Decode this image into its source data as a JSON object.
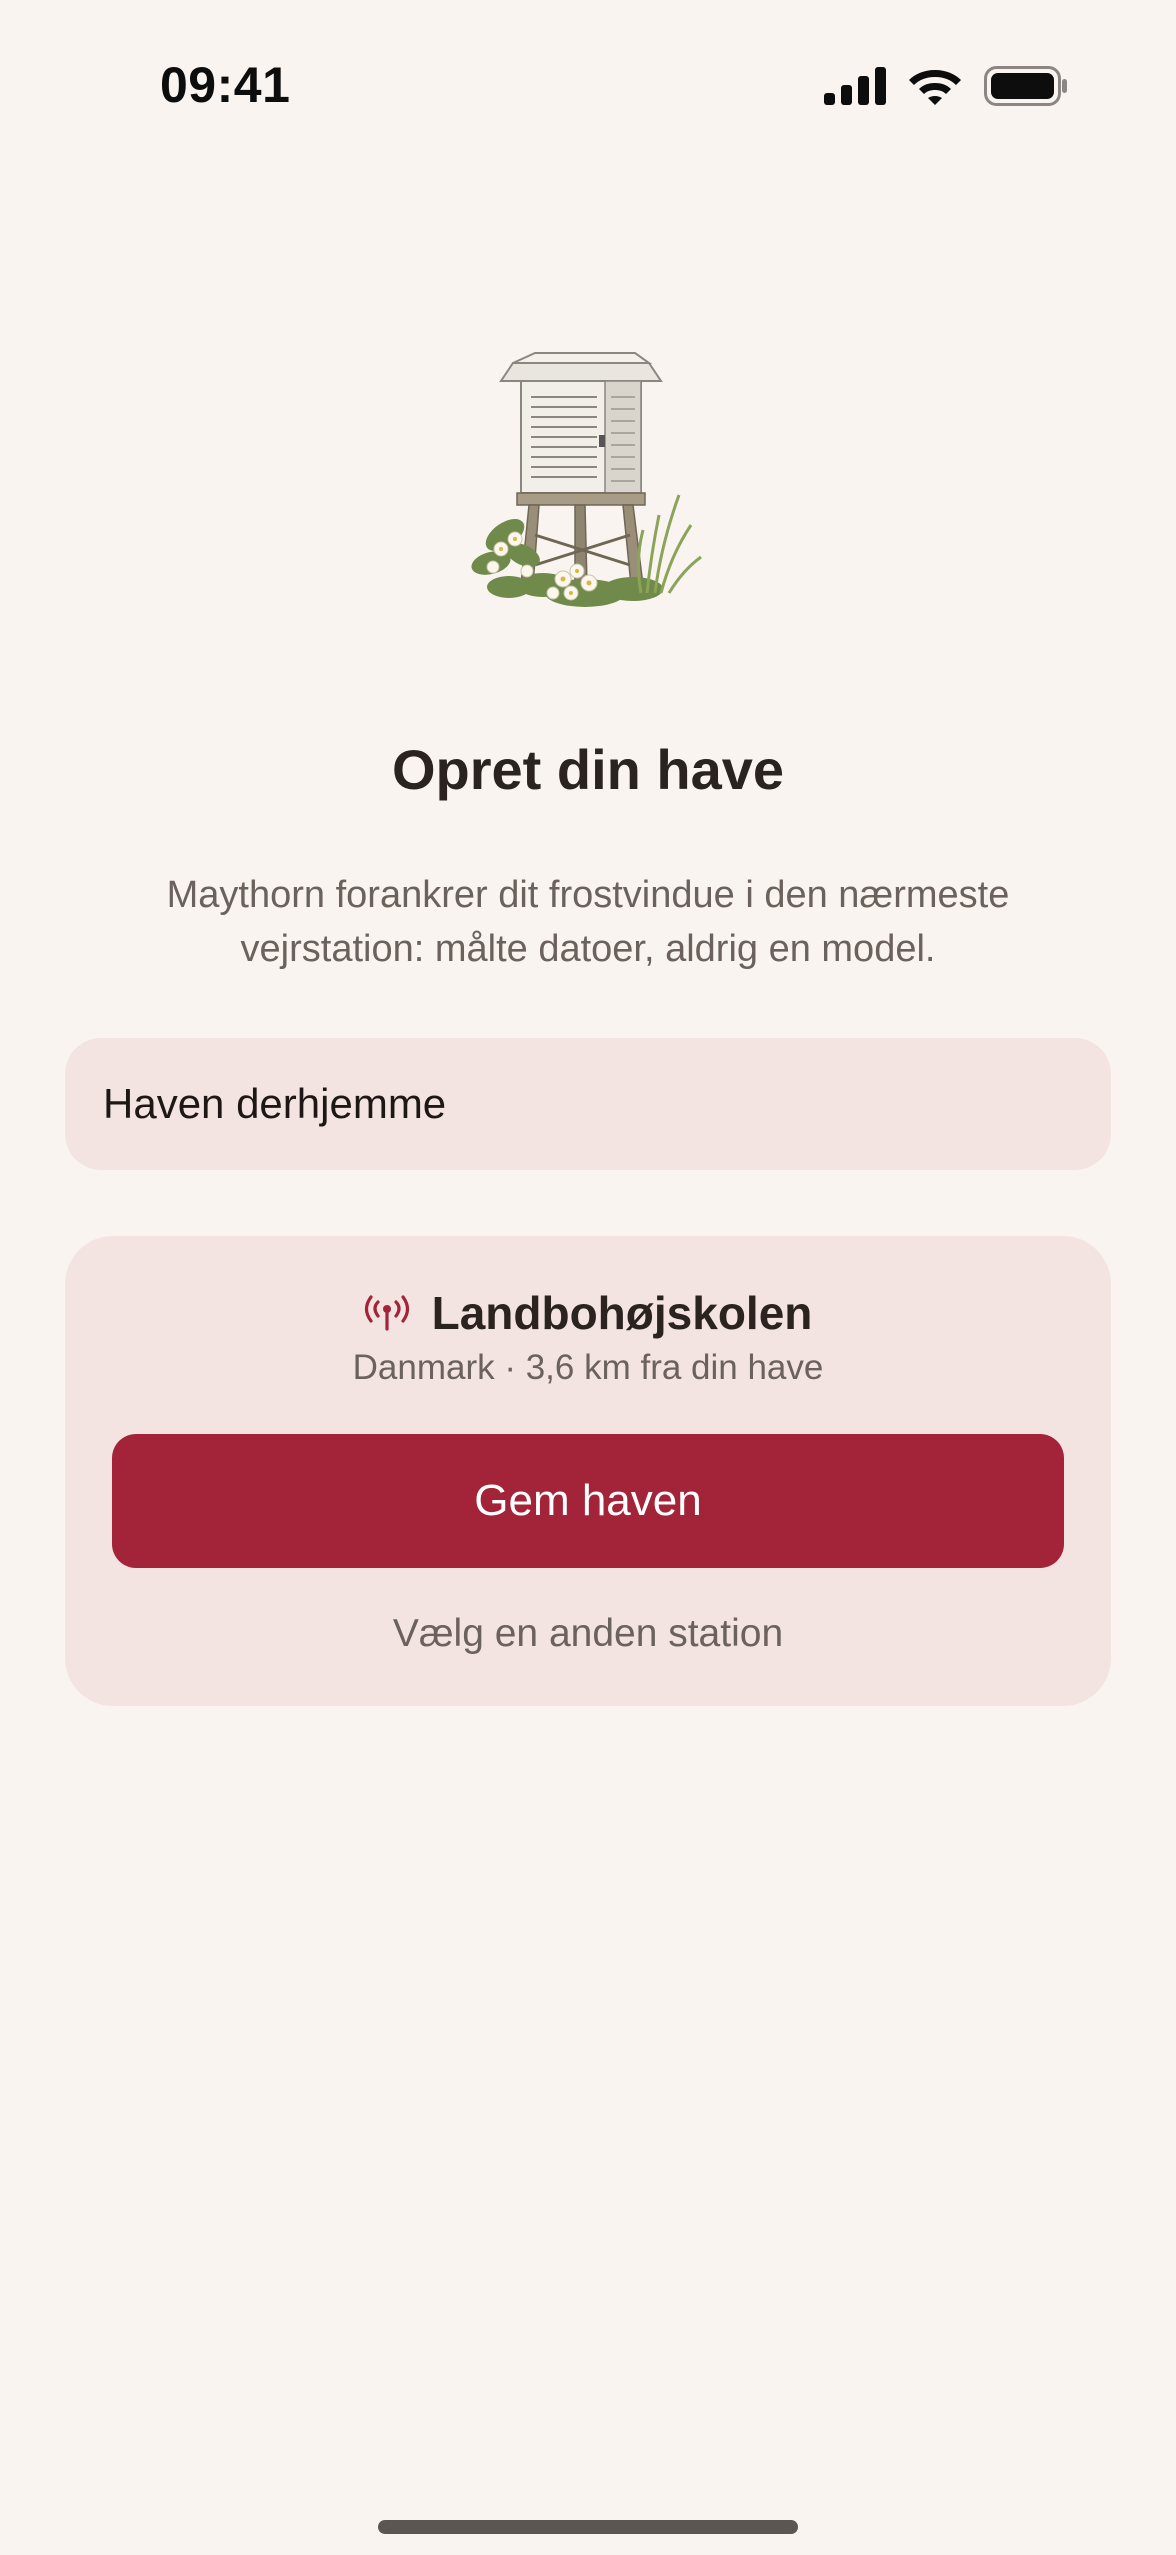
{
  "status_bar": {
    "time": "09:41",
    "icons": [
      "cellular-signal-icon",
      "wifi-icon",
      "battery-icon"
    ]
  },
  "illustration": {
    "icon": "weather-station-illustration"
  },
  "onboarding": {
    "title": "Opret din have",
    "description": "Maythorn forankrer dit frostvindue i den nærmeste vejrstation: målte datoer, aldrig en model."
  },
  "garden_name_field": {
    "value": "Haven derhjemme"
  },
  "station": {
    "icon": "antenna-signal-icon",
    "name": "Landbohøjskolen",
    "meta": "Danmark · 3,6 km fra din have",
    "save_label": "Gem haven",
    "change_label": "Vælg en anden station"
  },
  "colors": {
    "background": "#f9f4ef",
    "card": "#f4e4e1",
    "accent": "#a32438",
    "text_primary": "#2a2320",
    "text_secondary": "#6b625d"
  }
}
